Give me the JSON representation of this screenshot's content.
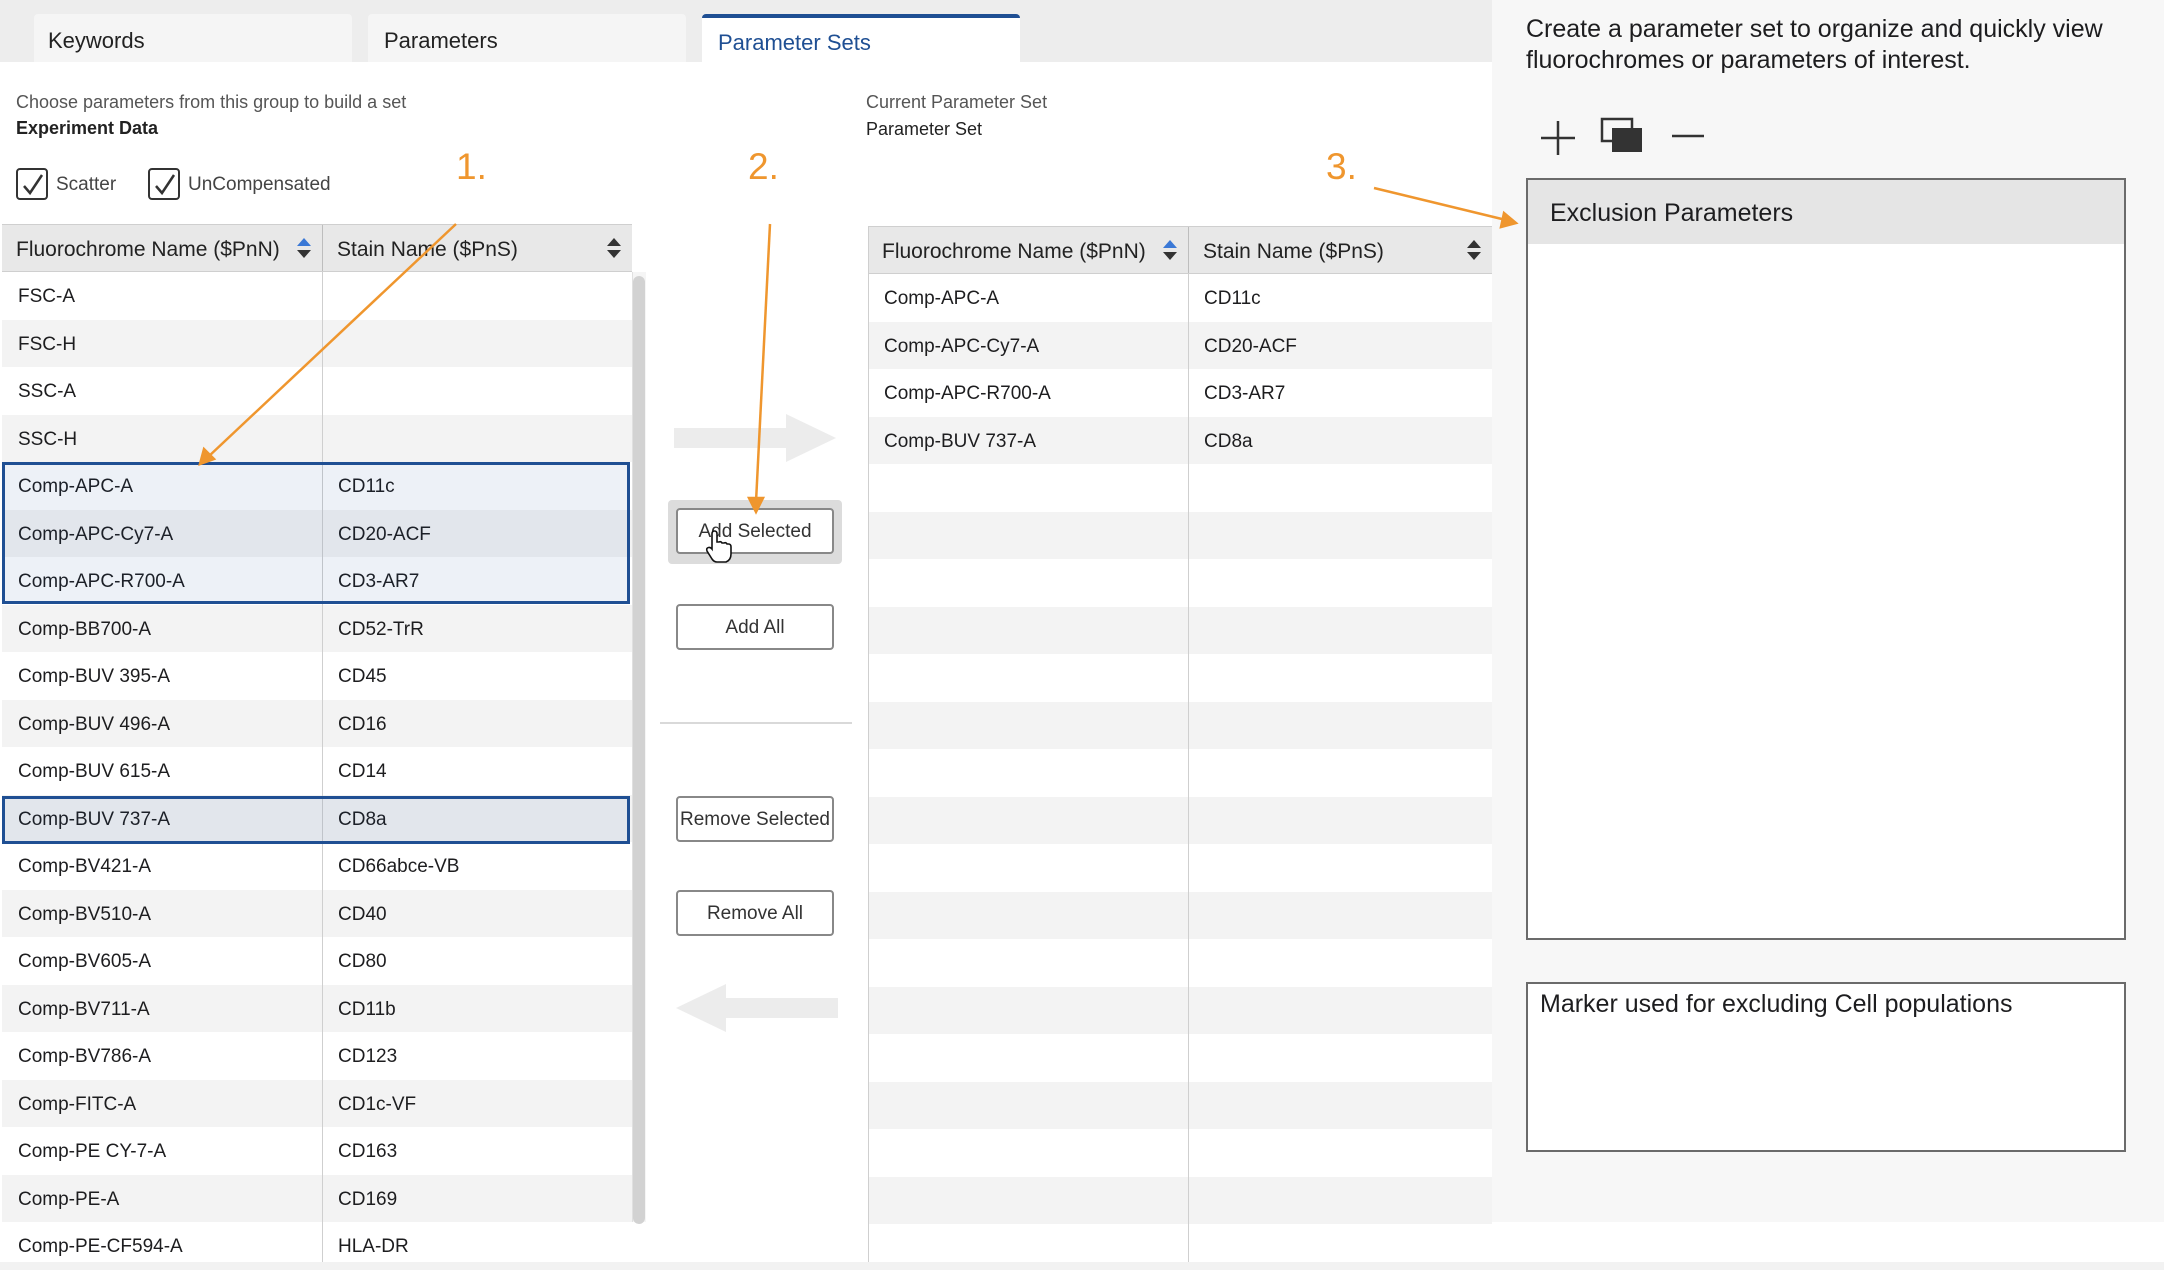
{
  "tabs": [
    {
      "label": "Keywords"
    },
    {
      "label": "Parameters"
    },
    {
      "label": "Parameter Sets",
      "active": true
    }
  ],
  "left": {
    "hint": "Choose parameters from this group to build a set",
    "group": "Experiment Data",
    "checkboxes": [
      {
        "label": "Scatter",
        "checked": true
      },
      {
        "label": "UnCompensated",
        "checked": true
      }
    ],
    "columns": [
      "Fluorochrome Name ($PnN)",
      "Stain Name ($PnS)"
    ],
    "rows": [
      {
        "fluor": "FSC-A",
        "stain": ""
      },
      {
        "fluor": "FSC-H",
        "stain": ""
      },
      {
        "fluor": "SSC-A",
        "stain": ""
      },
      {
        "fluor": "SSC-H",
        "stain": ""
      },
      {
        "fluor": "Comp-APC-A",
        "stain": "CD11c",
        "selected": true
      },
      {
        "fluor": "Comp-APC-Cy7-A",
        "stain": "CD20-ACF",
        "selected": true
      },
      {
        "fluor": "Comp-APC-R700-A",
        "stain": "CD3-AR7",
        "selected": true
      },
      {
        "fluor": "Comp-BB700-A",
        "stain": "CD52-TrR"
      },
      {
        "fluor": "Comp-BUV 395-A",
        "stain": "CD45"
      },
      {
        "fluor": "Comp-BUV 496-A",
        "stain": "CD16"
      },
      {
        "fluor": "Comp-BUV 615-A",
        "stain": "CD14"
      },
      {
        "fluor": "Comp-BUV 737-A",
        "stain": "CD8a",
        "selected": true
      },
      {
        "fluor": "Comp-BV421-A",
        "stain": "CD66abce-VB"
      },
      {
        "fluor": "Comp-BV510-A",
        "stain": "CD40"
      },
      {
        "fluor": "Comp-BV605-A",
        "stain": "CD80"
      },
      {
        "fluor": "Comp-BV711-A",
        "stain": "CD11b"
      },
      {
        "fluor": "Comp-BV786-A",
        "stain": "CD123"
      },
      {
        "fluor": "Comp-FITC-A",
        "stain": "CD1c-VF"
      },
      {
        "fluor": "Comp-PE CY-7-A",
        "stain": "CD163"
      },
      {
        "fluor": "Comp-PE-A",
        "stain": "CD169"
      },
      {
        "fluor": "Comp-PE-CF594-A",
        "stain": "HLA-DR"
      }
    ]
  },
  "buttons": {
    "add_selected": "Add Selected",
    "add_all": "Add All",
    "remove_selected": "Remove Selected",
    "remove_all": "Remove All"
  },
  "current": {
    "hint": "Current Parameter Set",
    "name": "Parameter Set",
    "columns": [
      "Fluorochrome Name ($PnN)",
      "Stain Name ($PnS)"
    ],
    "rows": [
      {
        "fluor": "Comp-APC-A",
        "stain": "CD11c"
      },
      {
        "fluor": "Comp-APC-Cy7-A",
        "stain": "CD20-ACF"
      },
      {
        "fluor": "Comp-APC-R700-A",
        "stain": "CD3-AR7"
      },
      {
        "fluor": "Comp-BUV 737-A",
        "stain": "CD8a"
      },
      {
        "fluor": "",
        "stain": ""
      },
      {
        "fluor": "",
        "stain": ""
      },
      {
        "fluor": "",
        "stain": ""
      },
      {
        "fluor": "",
        "stain": ""
      },
      {
        "fluor": "",
        "stain": ""
      },
      {
        "fluor": "",
        "stain": ""
      },
      {
        "fluor": "",
        "stain": ""
      },
      {
        "fluor": "",
        "stain": ""
      },
      {
        "fluor": "",
        "stain": ""
      },
      {
        "fluor": "",
        "stain": ""
      },
      {
        "fluor": "",
        "stain": ""
      },
      {
        "fluor": "",
        "stain": ""
      },
      {
        "fluor": "",
        "stain": ""
      },
      {
        "fluor": "",
        "stain": ""
      },
      {
        "fluor": "",
        "stain": ""
      },
      {
        "fluor": "",
        "stain": ""
      },
      {
        "fluor": "",
        "stain": ""
      }
    ]
  },
  "right": {
    "description": "Create a parameter set to organize and quickly view fluorochromes or parameters of interest.",
    "tools": [
      "plus-icon",
      "duplicate-icon",
      "minus-icon"
    ],
    "sets": [
      "Exclusion Parameters"
    ],
    "set_description": "Marker used for excluding Cell populations"
  },
  "annotations": [
    "1.",
    "2.",
    "3."
  ],
  "colors": {
    "accent": "#1f4f93",
    "annotation": "#ef962e",
    "sort_active": "#3a78d6"
  }
}
